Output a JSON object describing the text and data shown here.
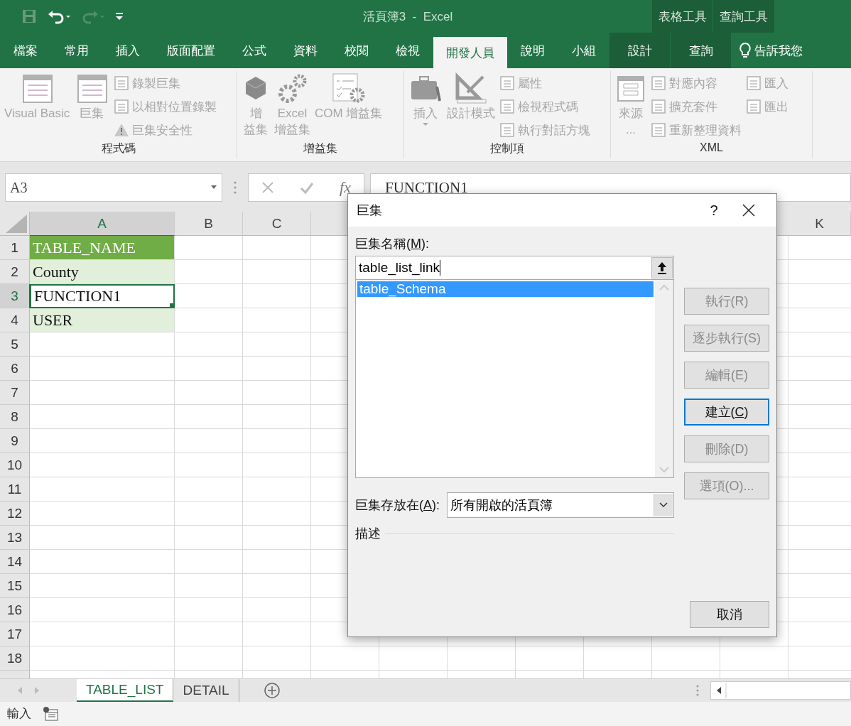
{
  "title_bar": {
    "title": "活頁簿3  -  Excel",
    "context_groups": [
      {
        "label": "表格工具"
      },
      {
        "label": "查詢工具"
      }
    ]
  },
  "ribbon_tabs": [
    {
      "label": "檔案",
      "selected": false,
      "contextual": false
    },
    {
      "label": "常用",
      "selected": false,
      "contextual": false
    },
    {
      "label": "插入",
      "selected": false,
      "contextual": false
    },
    {
      "label": "版面配置",
      "selected": false,
      "contextual": false
    },
    {
      "label": "公式",
      "selected": false,
      "contextual": false
    },
    {
      "label": "資料",
      "selected": false,
      "contextual": false
    },
    {
      "label": "校閱",
      "selected": false,
      "contextual": false
    },
    {
      "label": "檢視",
      "selected": false,
      "contextual": false
    },
    {
      "label": "開發人員",
      "selected": true,
      "contextual": false
    },
    {
      "label": "說明",
      "selected": false,
      "contextual": false
    },
    {
      "label": "小組",
      "selected": false,
      "contextual": false
    },
    {
      "label": "設計",
      "selected": false,
      "contextual": true
    },
    {
      "label": "查詢",
      "selected": false,
      "contextual": true
    }
  ],
  "tell_me": {
    "text": "告訴我您"
  },
  "ribbon_groups": [
    {
      "label": "程式碼",
      "items": [
        {
          "kind": "big",
          "lines": [
            "Visual Basic"
          ],
          "disabled": true
        },
        {
          "kind": "big",
          "lines": [
            "巨集"
          ],
          "disabled": true
        },
        {
          "kind": "column",
          "items": [
            {
              "label": "錄製巨集",
              "disabled": true
            },
            {
              "label": "以相對位置錄製",
              "disabled": true
            },
            {
              "label": "巨集安全性",
              "disabled": true
            }
          ]
        }
      ]
    },
    {
      "label": "增益集",
      "items": [
        {
          "kind": "big",
          "lines": [
            "增",
            "益集"
          ],
          "disabled": true
        },
        {
          "kind": "big",
          "lines": [
            "Excel",
            "增益集"
          ],
          "disabled": true
        },
        {
          "kind": "big",
          "lines": [
            "COM 增益集"
          ],
          "disabled": true
        }
      ]
    },
    {
      "label": "控制項",
      "items": [
        {
          "kind": "big",
          "lines": [
            "插入"
          ],
          "disabled": true,
          "dropdown": true
        },
        {
          "kind": "big",
          "lines": [
            "設計模式"
          ],
          "disabled": true
        },
        {
          "kind": "column",
          "items": [
            {
              "label": "屬性",
              "disabled": true
            },
            {
              "label": "檢視程式碼",
              "disabled": true
            },
            {
              "label": "執行對話方塊",
              "disabled": true
            }
          ]
        }
      ]
    },
    {
      "label": "XML",
      "items": [
        {
          "kind": "big",
          "lines": [
            "來源",
            "..."
          ],
          "disabled": true
        },
        {
          "kind": "column",
          "items": [
            {
              "label": "對應內容",
              "disabled": true
            },
            {
              "label": "擴充套件",
              "disabled": true
            },
            {
              "label": "重新整理資料",
              "disabled": true
            }
          ]
        },
        {
          "kind": "column",
          "items": [
            {
              "label": "匯入",
              "disabled": true
            },
            {
              "label": "匯出",
              "disabled": true
            }
          ]
        }
      ]
    }
  ],
  "formula_bar": {
    "name_box": "A3",
    "fx": "fx",
    "value": "FUNCTION1"
  },
  "sheet": {
    "columns": [
      {
        "label": "A",
        "selected": true
      },
      {
        "label": "B",
        "selected": false
      },
      {
        "label": "C",
        "selected": false
      },
      {
        "label": "K",
        "selected": false
      }
    ],
    "rows": [
      {
        "label": "1",
        "selected": false,
        "cells": [
          {
            "text": "TABLE_NAME",
            "kind": "header",
            "active": false
          }
        ]
      },
      {
        "label": "2",
        "selected": false,
        "cells": [
          {
            "text": "County",
            "kind": "band",
            "active": false
          }
        ]
      },
      {
        "label": "3",
        "selected": true,
        "cells": [
          {
            "text": "FUNCTION1",
            "kind": "band",
            "active": true
          }
        ]
      },
      {
        "label": "4",
        "selected": false,
        "cells": [
          {
            "text": "USER",
            "kind": "band",
            "active": false
          }
        ]
      },
      {
        "label": "5",
        "selected": false
      },
      {
        "label": "6",
        "selected": false
      },
      {
        "label": "7",
        "selected": false
      },
      {
        "label": "8",
        "selected": false
      },
      {
        "label": "9",
        "selected": false
      },
      {
        "label": "10",
        "selected": false
      },
      {
        "label": "11",
        "selected": false
      },
      {
        "label": "12",
        "selected": false
      },
      {
        "label": "13",
        "selected": false
      },
      {
        "label": "14",
        "selected": false
      },
      {
        "label": "15",
        "selected": false
      },
      {
        "label": "16",
        "selected": false
      },
      {
        "label": "17",
        "selected": false
      },
      {
        "label": "18",
        "selected": false
      }
    ]
  },
  "dialog": {
    "title": "巨集",
    "help": "?",
    "name_label": {
      "before": "巨集名稱(",
      "accel": "M",
      "after": "):"
    },
    "name_value": "table_list_link",
    "macros": [
      {
        "name": "table_Schema",
        "selected": true
      }
    ],
    "buttons": [
      {
        "label": "執行(R)",
        "disabled": true,
        "default": false
      },
      {
        "label": "逐步執行(S)",
        "disabled": true,
        "default": false
      },
      {
        "label": "編輯(E)",
        "disabled": true,
        "default": false
      },
      {
        "label": "建立(",
        "accel": "C",
        "after": ")",
        "disabled": false,
        "default": true
      },
      {
        "label": "刪除(D)",
        "disabled": true,
        "default": false
      },
      {
        "label": "選項(O)...",
        "disabled": true,
        "default": false
      }
    ],
    "store_label": {
      "before": "巨集存放在(",
      "accel": "A",
      "after": "):"
    },
    "store_value": "所有開啟的活頁簿",
    "description_label": "描述",
    "cancel": "取消"
  },
  "sheet_tabs": [
    {
      "label": "TABLE_LIST",
      "selected": true
    },
    {
      "label": "DETAIL",
      "selected": false
    }
  ],
  "status_bar": {
    "mode": "輸入"
  }
}
